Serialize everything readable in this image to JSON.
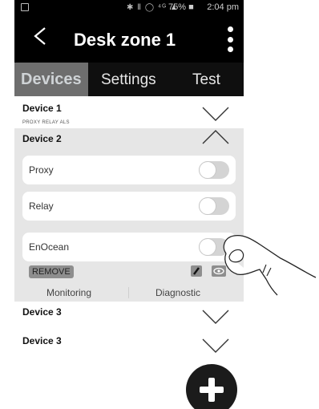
{
  "statusbar": {
    "icons": "✱ ⁠Ⅱ ◯ ⁴ᴳ ▲",
    "battery": "75% ■",
    "time": "2:04 pm"
  },
  "header": {
    "title": "Desk zone 1"
  },
  "tabs": [
    {
      "label": "Devices",
      "active": true
    },
    {
      "label": "Settings",
      "active": false
    },
    {
      "label": "Test",
      "active": false
    }
  ],
  "devices": [
    {
      "name": "Device 1",
      "subtitle": "PROXY RELAY ALS",
      "expanded": false
    },
    {
      "name": "Device 2",
      "subtitle": "",
      "expanded": true
    },
    {
      "name": "Device 3",
      "subtitle": "",
      "expanded": false
    },
    {
      "name": "Device 3",
      "subtitle": "",
      "expanded": false
    }
  ],
  "device2_options": [
    {
      "label": "Proxy",
      "on": false
    },
    {
      "label": "Relay",
      "on": false
    },
    {
      "label": "EnOcean",
      "on": false
    }
  ],
  "device2_actions": {
    "remove_label": "REMOVE"
  },
  "bottom_tabs": {
    "left": "Monitoring",
    "right": "Diagnostic"
  },
  "colors": {
    "header": "#000000",
    "active_tab": "#6e6e6e",
    "panel": "#e6e6e6",
    "fab": "#1b1b1b"
  }
}
